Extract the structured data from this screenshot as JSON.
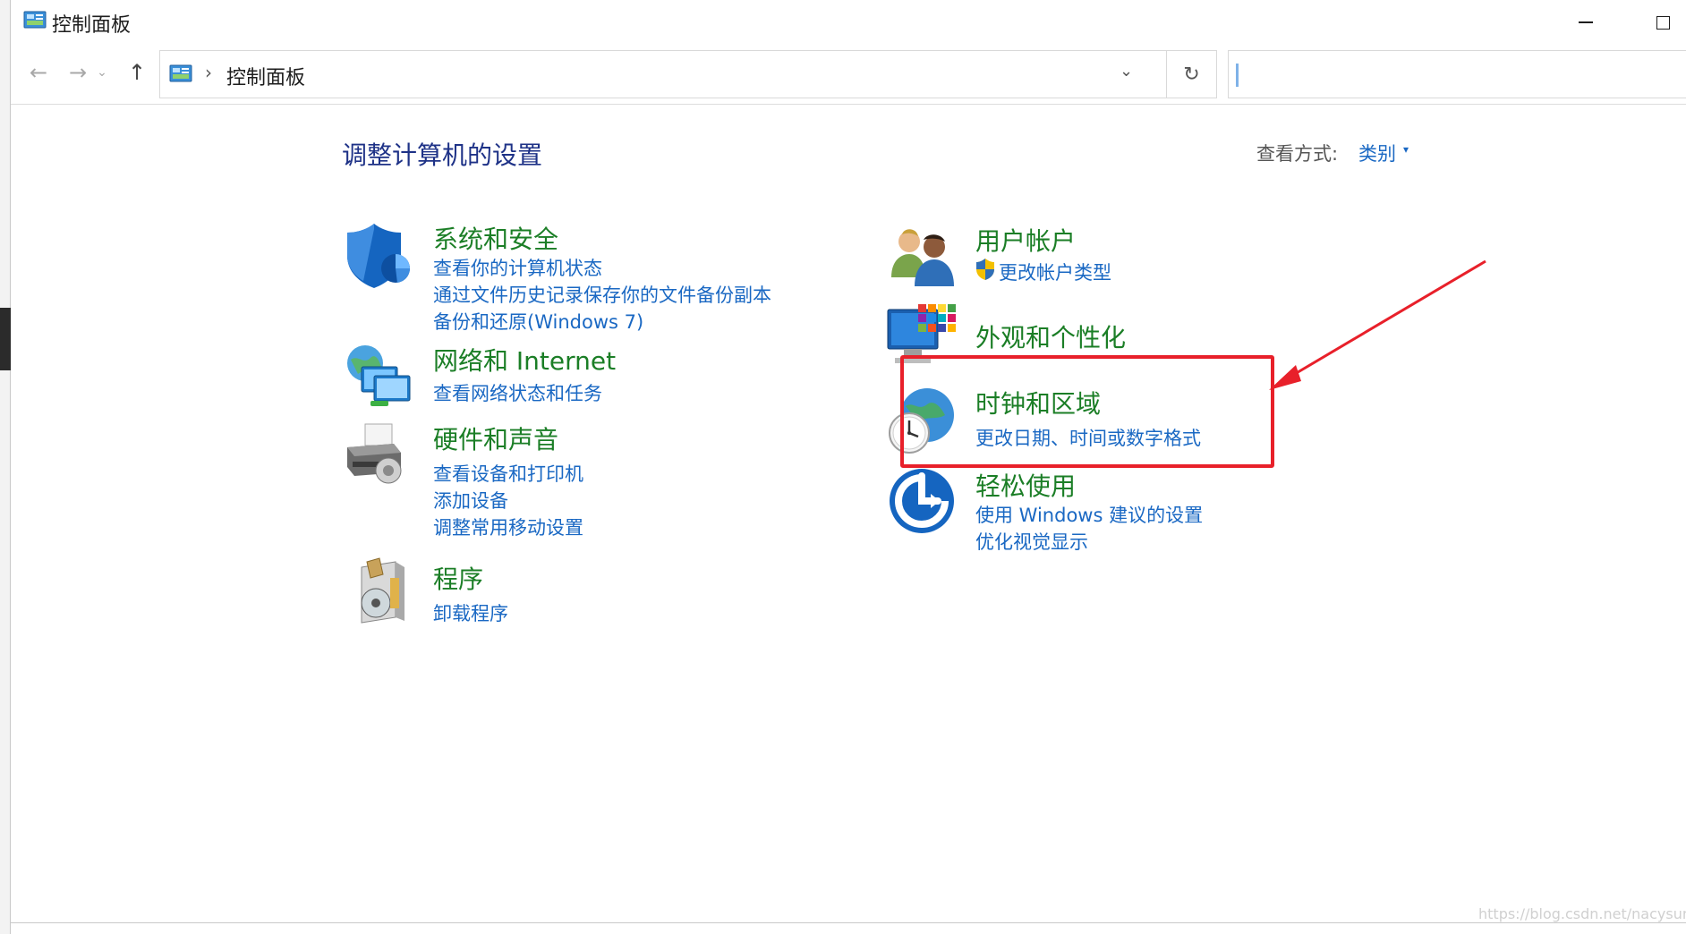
{
  "window": {
    "title": "控制面板",
    "minimize_glyph": "—",
    "maximize_glyph": "☐"
  },
  "navbar": {
    "back_icon": "←",
    "forward_icon": "→",
    "recent_icon": "⌄",
    "up_icon": "↑",
    "separator": "›",
    "path": "控制面板",
    "dropdown_icon": "⌄",
    "refresh_icon": "↻",
    "search_value": ""
  },
  "content": {
    "heading": "调整计算机的设置",
    "view_by_label": "查看方式:",
    "view_by_value": "类别",
    "view_by_caret": "▾"
  },
  "categories": {
    "system_security": {
      "icon": "shield-icon",
      "title": "系统和安全",
      "links": [
        "查看你的计算机状态",
        "通过文件历史记录保存你的文件备份副本",
        "备份和还原(Windows 7)"
      ]
    },
    "network": {
      "icon": "network-icon",
      "title": "网络和 Internet",
      "links": [
        "查看网络状态和任务"
      ]
    },
    "hardware": {
      "icon": "printer-icon",
      "title": "硬件和声音",
      "links": [
        "查看设备和打印机",
        "添加设备",
        "调整常用移动设置"
      ]
    },
    "programs": {
      "icon": "programs-icon",
      "title": "程序",
      "links": [
        "卸载程序"
      ]
    },
    "user_accounts": {
      "icon": "users-icon",
      "title": "用户帐户",
      "links": [
        "更改帐户类型"
      ]
    },
    "appearance": {
      "icon": "monitor-icon",
      "title": "外观和个性化",
      "links": []
    },
    "clock_region": {
      "icon": "clock-globe-icon",
      "title": "时钟和区域",
      "links": [
        "更改日期、时间或数字格式"
      ]
    },
    "ease_of_access": {
      "icon": "ease-of-access-icon",
      "title": "轻松使用",
      "links": [
        "使用 Windows 建议的设置",
        "优化视觉显示"
      ]
    }
  },
  "colors": {
    "category_title": "#1b7e26",
    "link": "#1a68c3",
    "heading": "#1e3287",
    "annotation": "#e8202a"
  },
  "watermark": "https://blog.csdn.net/nacysummer"
}
